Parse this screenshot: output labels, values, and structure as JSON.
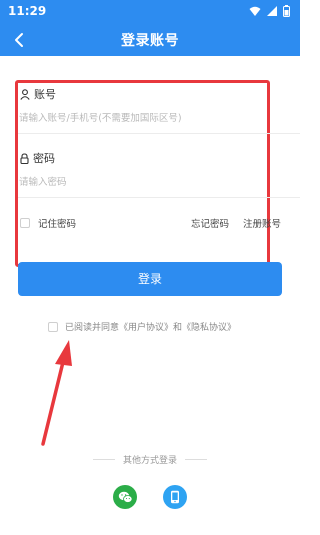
{
  "status_bar": {
    "time": "11:29"
  },
  "nav": {
    "title": "登录账号"
  },
  "form": {
    "account_label": "账号",
    "account_placeholder": "请输入账号/手机号(不需要加国际区号)",
    "password_label": "密码",
    "password_placeholder": "请输入密码",
    "remember_label": "记住密码",
    "forgot_label": "忘记密码",
    "register_label": "注册账号"
  },
  "login_button": "登录",
  "agreement": "已阅读并同意《用户协议》和《隐私协议》",
  "other_login": {
    "label": "其他方式登录"
  },
  "colors": {
    "primary": "#2d8cf0",
    "highlight": "#e8383d",
    "wechat": "#2bad48",
    "phone": "#2ea3f2"
  }
}
